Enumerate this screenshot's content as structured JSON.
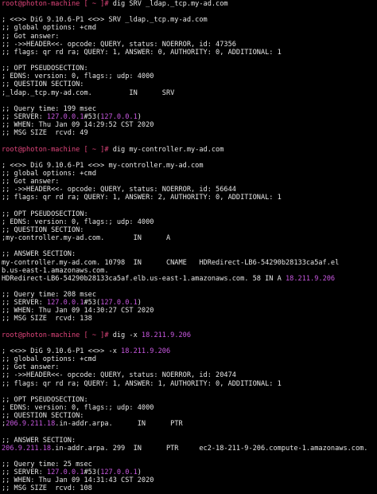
{
  "lines": [
    {
      "segs": [
        {
          "t": "root@photon-machine [ ~ ]# ",
          "c": "prompt"
        },
        {
          "t": "dig SRV _ldap._tcp.my-ad.com"
        }
      ]
    },
    {
      "segs": [
        {
          "t": ""
        }
      ]
    },
    {
      "segs": [
        {
          "t": "; <<>> DiG 9.10.6-P1 <<>> SRV _ldap._tcp.my-ad.com"
        }
      ]
    },
    {
      "segs": [
        {
          "t": ";; global options: +cmd"
        }
      ]
    },
    {
      "segs": [
        {
          "t": ";; Got answer:"
        }
      ]
    },
    {
      "segs": [
        {
          "t": ";; ->>HEADER<<- opcode: QUERY, status: NOERROR, id: 47356"
        }
      ]
    },
    {
      "segs": [
        {
          "t": ";; flags: qr rd ra; QUERY: 1, ANSWER: 0, AUTHORITY: 0, ADDITIONAL: 1"
        }
      ]
    },
    {
      "segs": [
        {
          "t": ""
        }
      ]
    },
    {
      "segs": [
        {
          "t": ";; OPT PSEUDOSECTION:"
        }
      ]
    },
    {
      "segs": [
        {
          "t": "; EDNS: version: 0, flags:; udp: 4000"
        }
      ]
    },
    {
      "segs": [
        {
          "t": ";; QUESTION SECTION:"
        }
      ]
    },
    {
      "segs": [
        {
          "t": ";_ldap._tcp.my-ad.com.         IN      SRV"
        }
      ]
    },
    {
      "segs": [
        {
          "t": ""
        }
      ]
    },
    {
      "segs": [
        {
          "t": ";; Query time: 199 msec"
        }
      ]
    },
    {
      "segs": [
        {
          "t": ";; SERVER: "
        },
        {
          "t": "127.0.0.1",
          "c": "ip"
        },
        {
          "t": "#53("
        },
        {
          "t": "127.0.0.1",
          "c": "ip"
        },
        {
          "t": ")"
        }
      ]
    },
    {
      "segs": [
        {
          "t": ";; WHEN: Thu Jan 09 14:29:52 CST 2020"
        }
      ]
    },
    {
      "segs": [
        {
          "t": ";; MSG SIZE  rcvd: 49"
        }
      ]
    },
    {
      "segs": [
        {
          "t": ""
        }
      ]
    },
    {
      "segs": [
        {
          "t": "root@photon-machine [ ~ ]# ",
          "c": "prompt"
        },
        {
          "t": "dig my-controller.my-ad.com"
        }
      ]
    },
    {
      "segs": [
        {
          "t": ""
        }
      ]
    },
    {
      "segs": [
        {
          "t": "; <<>> DiG 9.10.6-P1 <<>> my-controller.my-ad.com"
        }
      ]
    },
    {
      "segs": [
        {
          "t": ";; global options: +cmd"
        }
      ]
    },
    {
      "segs": [
        {
          "t": ";; Got answer:"
        }
      ]
    },
    {
      "segs": [
        {
          "t": ";; ->>HEADER<<- opcode: QUERY, status: NOERROR, id: 56644"
        }
      ]
    },
    {
      "segs": [
        {
          "t": ";; flags: qr rd ra; QUERY: 1, ANSWER: 2, AUTHORITY: 0, ADDITIONAL: 1"
        }
      ]
    },
    {
      "segs": [
        {
          "t": ""
        }
      ]
    },
    {
      "segs": [
        {
          "t": ";; OPT PSEUDOSECTION:"
        }
      ]
    },
    {
      "segs": [
        {
          "t": "; EDNS: version: 0, flags:; udp: 4000"
        }
      ]
    },
    {
      "segs": [
        {
          "t": ";; QUESTION SECTION:"
        }
      ]
    },
    {
      "segs": [
        {
          "t": ";my-controller.my-ad.com.       IN      A"
        }
      ]
    },
    {
      "segs": [
        {
          "t": ""
        }
      ]
    },
    {
      "segs": [
        {
          "t": ";; ANSWER SECTION:"
        }
      ]
    },
    {
      "segs": [
        {
          "t": "my-controller.my-ad.com. 10798  IN      CNAME   HDRedirect-LB6-54290b28133ca5af.el"
        }
      ]
    },
    {
      "segs": [
        {
          "t": "b.us-east-1.amazonaws.com."
        }
      ]
    },
    {
      "segs": [
        {
          "t": "HDRedirect-LB6-54290b28133ca5af.elb.us-east-1.amazonaws.com. 58 IN A "
        },
        {
          "t": "18.211.9.206",
          "c": "ip"
        }
      ]
    },
    {
      "segs": [
        {
          "t": ""
        }
      ]
    },
    {
      "segs": [
        {
          "t": ";; Query time: 208 msec"
        }
      ]
    },
    {
      "segs": [
        {
          "t": ";; SERVER: "
        },
        {
          "t": "127.0.0.1",
          "c": "ip"
        },
        {
          "t": "#53("
        },
        {
          "t": "127.0.0.1",
          "c": "ip"
        },
        {
          "t": ")"
        }
      ]
    },
    {
      "segs": [
        {
          "t": ";; WHEN: Thu Jan 09 14:30:27 CST 2020"
        }
      ]
    },
    {
      "segs": [
        {
          "t": ";; MSG SIZE  rcvd: 138"
        }
      ]
    },
    {
      "segs": [
        {
          "t": ""
        }
      ]
    },
    {
      "segs": [
        {
          "t": "root@photon-machine [ ~ ]# ",
          "c": "prompt"
        },
        {
          "t": "dig -x "
        },
        {
          "t": "18.211.9.206",
          "c": "ip"
        }
      ]
    },
    {
      "segs": [
        {
          "t": ""
        }
      ]
    },
    {
      "segs": [
        {
          "t": "; <<>> DiG 9.10.6-P1 <<>> -x "
        },
        {
          "t": "18.211.9.206",
          "c": "ip"
        }
      ]
    },
    {
      "segs": [
        {
          "t": ";; global options: +cmd"
        }
      ]
    },
    {
      "segs": [
        {
          "t": ";; Got answer:"
        }
      ]
    },
    {
      "segs": [
        {
          "t": ";; ->>HEADER<<- opcode: QUERY, status: NOERROR, id: 20474"
        }
      ]
    },
    {
      "segs": [
        {
          "t": ";; flags: qr rd ra; QUERY: 1, ANSWER: 1, AUTHORITY: 0, ADDITIONAL: 1"
        }
      ]
    },
    {
      "segs": [
        {
          "t": ""
        }
      ]
    },
    {
      "segs": [
        {
          "t": ";; OPT PSEUDOSECTION:"
        }
      ]
    },
    {
      "segs": [
        {
          "t": "; EDNS: version: 0, flags:; udp: 4000"
        }
      ]
    },
    {
      "segs": [
        {
          "t": ";; QUESTION SECTION:"
        }
      ]
    },
    {
      "segs": [
        {
          "t": ";"
        },
        {
          "t": "206.9.211.18",
          "c": "ip"
        },
        {
          "t": ".in-addr.arpa.      IN      PTR"
        }
      ]
    },
    {
      "segs": [
        {
          "t": ""
        }
      ]
    },
    {
      "segs": [
        {
          "t": ";; ANSWER SECTION:"
        }
      ]
    },
    {
      "segs": [
        {
          "t": "206.9.211.18",
          "c": "ip"
        },
        {
          "t": ".in-addr.arpa. 299  IN      PTR     ec2-18-211-9-206.compute-1.amazonaws.com."
        }
      ]
    },
    {
      "segs": [
        {
          "t": ""
        }
      ]
    },
    {
      "segs": [
        {
          "t": ";; Query time: 25 msec"
        }
      ]
    },
    {
      "segs": [
        {
          "t": ";; SERVER: "
        },
        {
          "t": "127.0.0.1",
          "c": "ip"
        },
        {
          "t": "#53("
        },
        {
          "t": "127.0.0.1",
          "c": "ip"
        },
        {
          "t": ")"
        }
      ]
    },
    {
      "segs": [
        {
          "t": ";; WHEN: Thu Jan 09 14:31:43 CST 2020"
        }
      ]
    },
    {
      "segs": [
        {
          "t": ";; MSG SIZE  rcvd: 108"
        }
      ]
    },
    {
      "segs": [
        {
          "t": ""
        }
      ]
    },
    {
      "segs": [
        {
          "t": "root@photon-machine [ ~ ]# ",
          "c": "prompt"
        },
        {
          "t": "",
          "c": "cursor"
        }
      ]
    }
  ],
  "colors": {
    "background": "#000000",
    "foreground": "#e6e6e6",
    "prompt": "#e0457b",
    "ip_highlight": "#c858e0"
  }
}
